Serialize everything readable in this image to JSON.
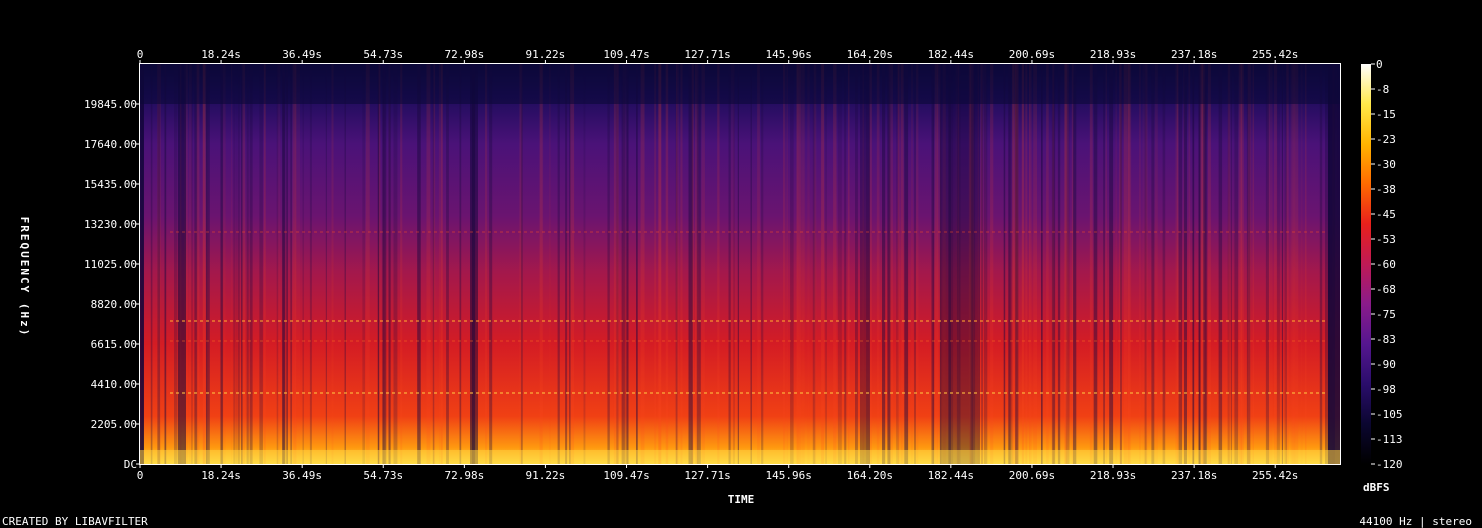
{
  "chart_data": {
    "type": "heatmap",
    "subtype": "spectrogram",
    "xlabel": "TIME",
    "ylabel": "FREQUENCY (Hz)",
    "x_ticks": [
      "0",
      "18.24s",
      "36.49s",
      "54.73s",
      "72.98s",
      "91.22s",
      "109.47s",
      "127.71s",
      "145.96s",
      "164.20s",
      "182.44s",
      "200.69s",
      "218.93s",
      "237.18s",
      "255.42s"
    ],
    "y_ticks": [
      "DC",
      "2205.00",
      "4410.00",
      "6615.00",
      "8820.00",
      "11025.00",
      "13230.00",
      "15435.00",
      "17640.00",
      "19845.00"
    ],
    "xlim": [
      0,
      270
    ],
    "ylim": [
      0,
      22050
    ],
    "colorbar": {
      "label": "dBFS",
      "ticks": [
        "0",
        "-8",
        "-15",
        "-23",
        "-30",
        "-38",
        "-45",
        "-53",
        "-60",
        "-68",
        "-75",
        "-83",
        "-90",
        "-98",
        "-105",
        "-113",
        "-120"
      ],
      "range": [
        -120,
        0
      ],
      "colormap": [
        "#000000",
        "#0b0630",
        "#2a0d6b",
        "#55168f",
        "#8a1b8a",
        "#c01a55",
        "#e8201c",
        "#ff6a00",
        "#ffb400",
        "#ffe94a",
        "#ffffff"
      ]
    },
    "grid": false
  },
  "footer": {
    "left": "CREATED BY LIBAVFILTER",
    "right": "44100 Hz | stereo"
  }
}
